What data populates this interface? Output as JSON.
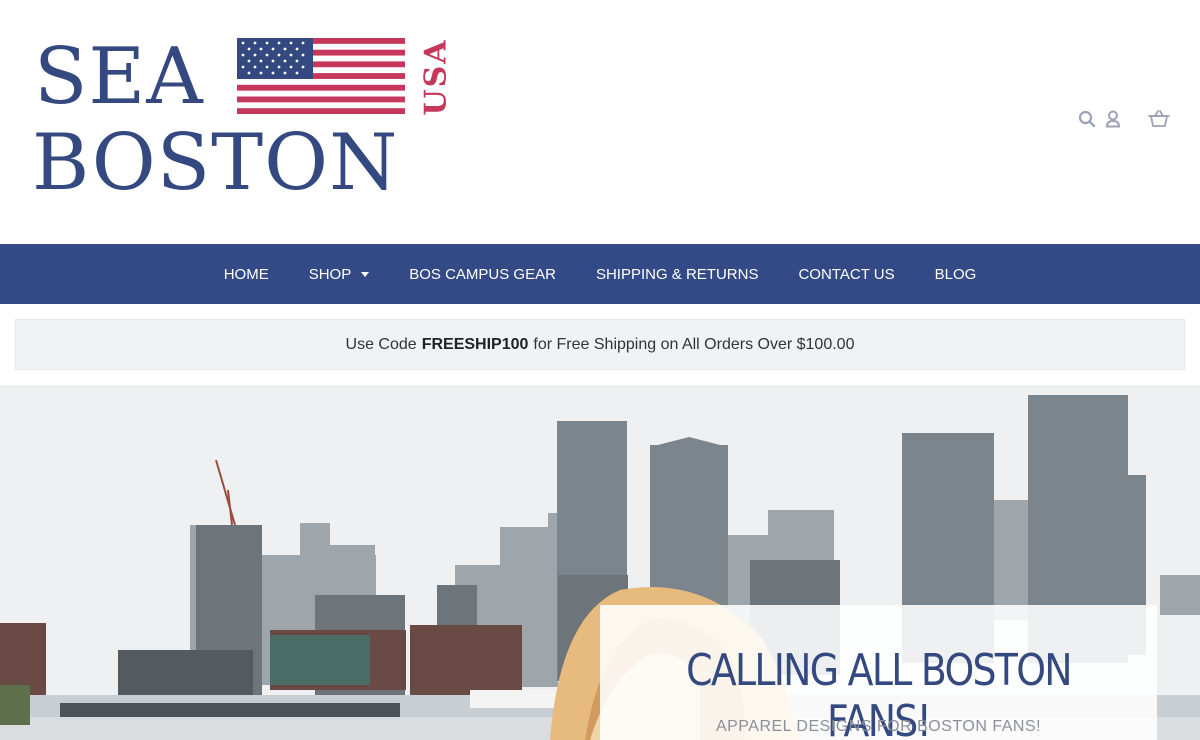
{
  "logo": {
    "line1": "SEA",
    "line2": "BOSTON",
    "usa": "USA"
  },
  "header_icons": [
    "search-icon",
    "account-icon",
    "cart-icon"
  ],
  "nav": {
    "items": [
      {
        "label": "HOME"
      },
      {
        "label": "SHOP"
      },
      {
        "label": "BOS CAMPUS GEAR"
      },
      {
        "label": "SHIPPING & RETURNS"
      },
      {
        "label": "CONTACT US"
      },
      {
        "label": "BLOG"
      }
    ]
  },
  "promo": {
    "prefix": "Use Code",
    "code": "FREESHIP100",
    "suffix": "for Free Shipping on All Orders Over $100.00"
  },
  "hero": {
    "title": "CALLING ALL BOSTON FANS!",
    "subtitle": "APPAREL DESIGNS FOR BOSTON FANS!"
  },
  "colors": {
    "brand_blue": "#344a86",
    "brand_red": "#c6385b",
    "promo_bg": "#f1f2f6"
  }
}
